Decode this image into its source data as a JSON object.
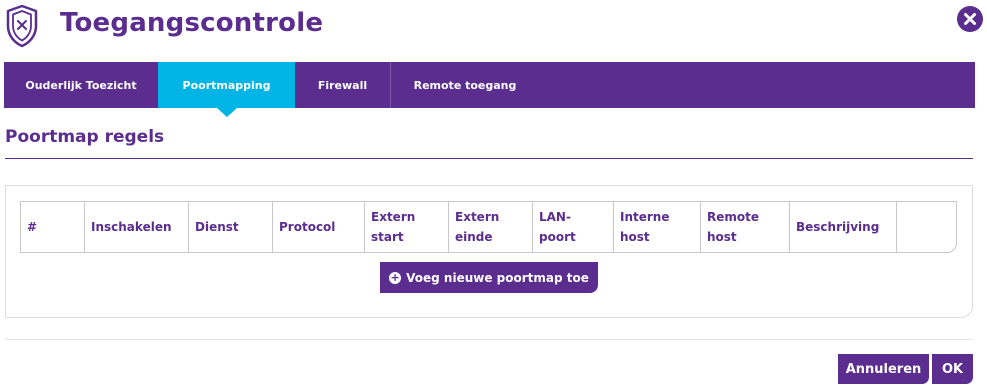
{
  "header": {
    "title": "Toegangscontrole",
    "icons": {
      "shield": "shield-x-icon",
      "close": "close-circle-icon"
    }
  },
  "tabs": [
    {
      "label": "Ouderlijk Toezicht",
      "active": false
    },
    {
      "label": "Poortmapping",
      "active": true
    },
    {
      "label": "Firewall",
      "active": false
    },
    {
      "label": "Remote toegang",
      "active": false
    }
  ],
  "section": {
    "title": "Poortmap regels"
  },
  "table": {
    "headers": [
      [
        "#"
      ],
      [
        "Inschakelen"
      ],
      [
        "Dienst"
      ],
      [
        "Protocol"
      ],
      [
        "Extern",
        "start"
      ],
      [
        "Extern",
        "einde"
      ],
      [
        "LAN-",
        "poort"
      ],
      [
        "Interne",
        "host"
      ],
      [
        "Remote",
        "host"
      ],
      [
        "Beschrijving"
      ],
      [
        ""
      ]
    ],
    "rows": []
  },
  "add_button": {
    "label": "Voeg nieuwe poortmap toe",
    "icon": "plus-circle-icon"
  },
  "footer": {
    "cancel_label": "Annuleren",
    "ok_label": "OK"
  },
  "colors": {
    "primary": "#5b2d8e",
    "active_tab": "#00b4e6",
    "border": "#c8c8c8"
  }
}
